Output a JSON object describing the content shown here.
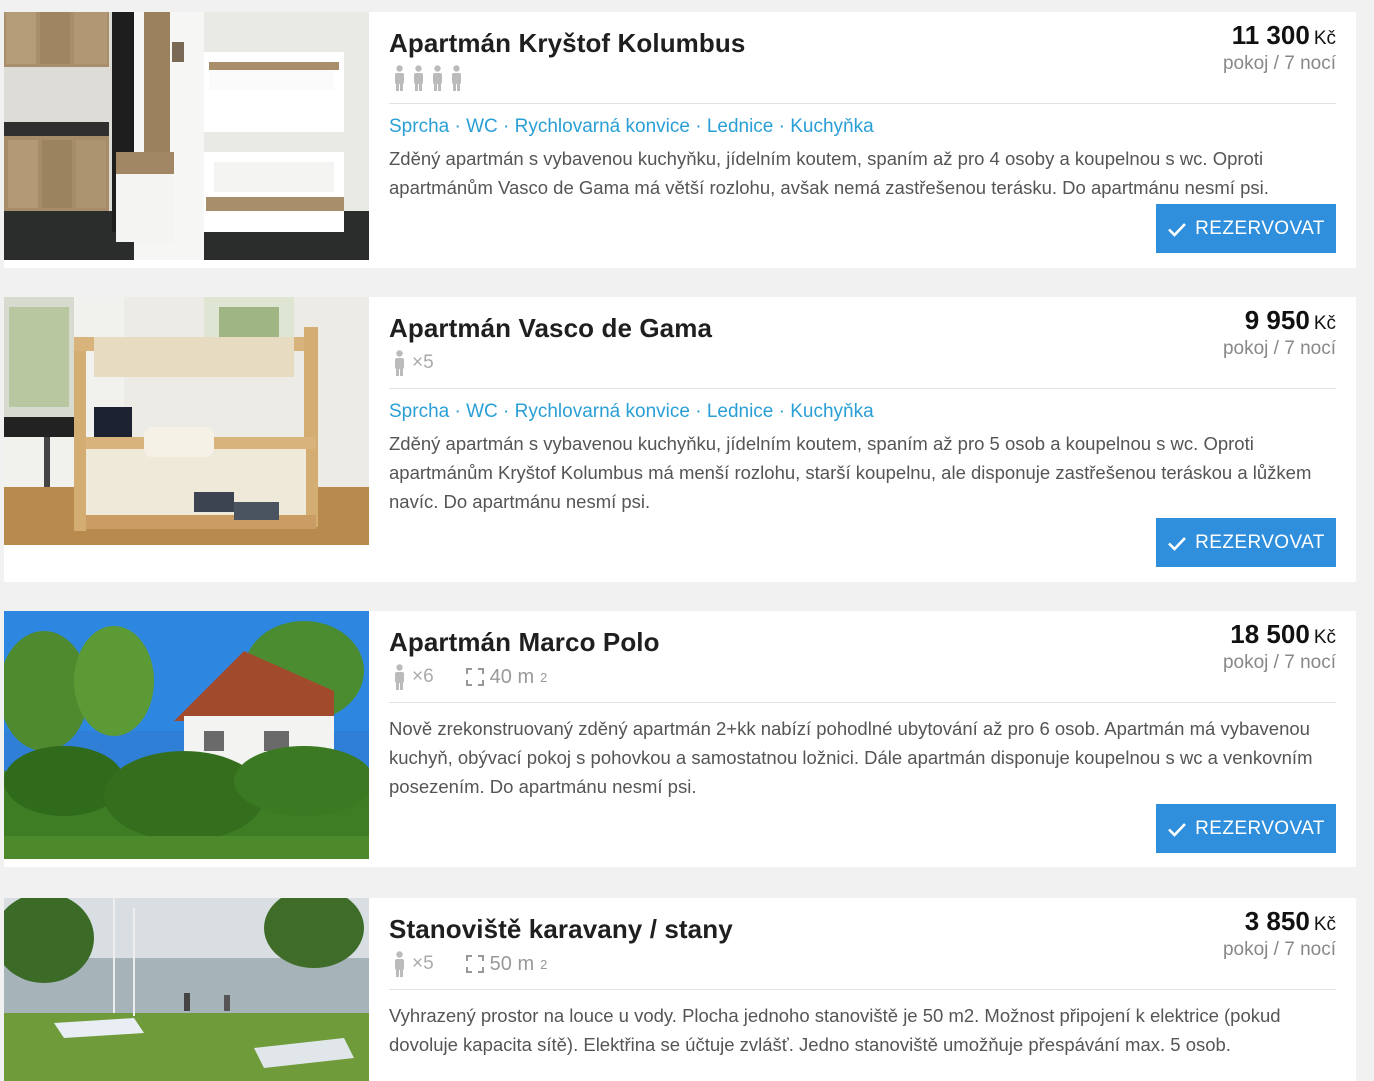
{
  "listings": [
    {
      "title": "Apartmán Kryštof Kolumbus",
      "price": "11 300",
      "currency": "Kč",
      "price_unit": "pokoj / 7 nocí",
      "persons_icons": 4,
      "persons_text": "",
      "area_value": "",
      "area_unit": "",
      "amenities": "Sprcha · WC · Rychlovarná konvice · Lednice · Kuchyňka",
      "description": "Zděný apartmán s vybavenou kuchyňku, jídelním koutem, spaním až pro 4 osoby a koupelnou s wc. Oproti apartmánům Vasco de Gama má větší rozlohu, avšak nemá zastřešenou terásku. Do apartmánu nesmí psi.",
      "button": "REZERVOVAT"
    },
    {
      "title": "Apartmán Vasco de Gama",
      "price": "9 950",
      "currency": "Kč",
      "price_unit": "pokoj / 7 nocí",
      "persons_icons": 1,
      "persons_text": "×5",
      "area_value": "",
      "area_unit": "",
      "amenities": "Sprcha · WC · Rychlovarná konvice · Lednice · Kuchyňka",
      "description": "Zděný apartmán s vybavenou kuchyňku, jídelním koutem, spaním až pro 5 osob a koupelnou s wc. Oproti apartmánům Kryštof Kolumbus má menší rozlohu, starší koupelnu, ale disponuje zastřešenou teráskou a lůžkem navíc. Do apartmánu nesmí psi.",
      "button": "REZERVOVAT"
    },
    {
      "title": "Apartmán Marco Polo",
      "price": "18 500",
      "currency": "Kč",
      "price_unit": "pokoj / 7 nocí",
      "persons_icons": 1,
      "persons_text": "×6",
      "area_value": "40 m",
      "area_unit": "2",
      "amenities": "",
      "description": "Nově zrekonstruovaný zděný apartmán 2+kk nabízí pohodlné ubytování až pro 6 osob. Apartmán má vybavenou kuchyň, obývací pokoj s pohovkou a samostatnou ložnici. Dále apartmán disponuje koupelnou s wc a venkovním posezením. Do apartmánu nesmí psi.",
      "button": "REZERVOVAT"
    },
    {
      "title": "Stanoviště karavany / stany",
      "price": "3 850",
      "currency": "Kč",
      "price_unit": "pokoj / 7 nocí",
      "persons_icons": 1,
      "persons_text": "×5",
      "area_value": "50 m",
      "area_unit": "2",
      "amenities": "",
      "description": "Vyhrazený prostor na louce u vody. Plocha jednoho stanoviště je 50 m2. Možnost připojení k elektrice (pokud dovoluje kapacita sítě). Elektřina se účtuje zvlášť. Jedno stanoviště umožňuje přespávání max. 5 osob.",
      "button": ""
    }
  ],
  "colors": {
    "accent_link": "#2a9fd6",
    "button_bg": "#2f8fdc",
    "page_bg": "#f1f1f1"
  },
  "icons": {
    "person": "person-icon",
    "area": "area-icon",
    "check": "check-icon"
  }
}
